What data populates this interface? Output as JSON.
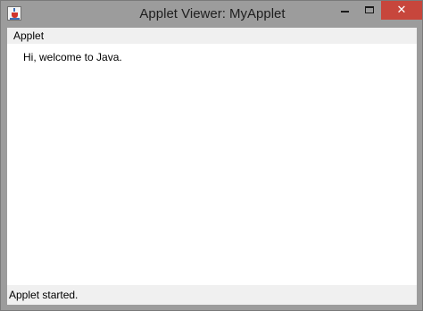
{
  "window": {
    "title": "Applet Viewer: MyApplet",
    "icon": "java-cup-icon",
    "controls": {
      "minimize_icon": "minimize-icon",
      "maximize_icon": "maximize-icon",
      "close_label": "✕",
      "close_color": "#c7463c"
    }
  },
  "menubar": {
    "items": [
      {
        "label": "Applet"
      }
    ]
  },
  "content": {
    "message": "Hi, welcome to Java."
  },
  "status": {
    "text": "Applet started."
  }
}
